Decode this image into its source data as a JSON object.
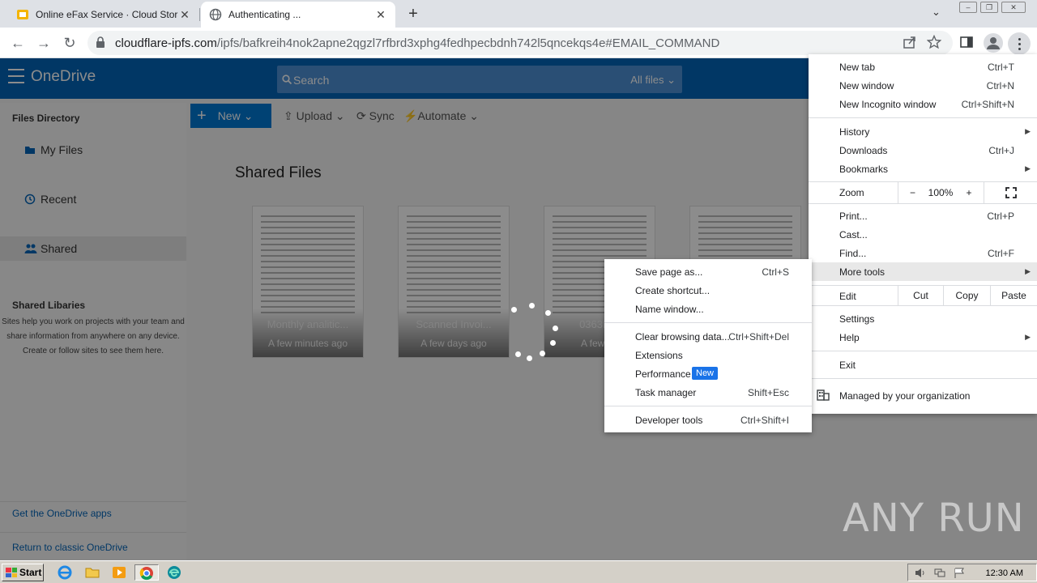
{
  "tabs": [
    {
      "title": "Online eFax Service · Cloud Storage",
      "icon": "fax-favicon"
    },
    {
      "title": "Authenticating ...",
      "icon": "globe-favicon"
    }
  ],
  "address": {
    "host": "cloudflare-ipfs.com",
    "path": "/ipfs/bafkreih4nok2apne2qgzl7rfbrd3xphg4fedhpecbdnh742l5qncekqs4e#EMAIL_COMMAND"
  },
  "onedrive": {
    "brand": "OneDrive",
    "search_placeholder": "Search",
    "search_scope": "All files"
  },
  "sidebar": {
    "heading": "Files Directory",
    "items": [
      {
        "label": "My Files"
      },
      {
        "label": "Recent"
      },
      {
        "label": "Shared"
      }
    ],
    "libraries_heading": "Shared Libaries",
    "libraries_desc": "Sites help you work on projects with your team and share information from anywhere on any device. Create or follow sites to see them here.",
    "get_apps": "Get the OneDrive apps",
    "return_classic": "Return to classic OneDrive"
  },
  "commands": {
    "new": "New",
    "upload": "Upload",
    "sync": "Sync",
    "automate": "Automate"
  },
  "main": {
    "title": "Shared Files",
    "tiles": [
      {
        "name": "Monthly analitic...",
        "time": "A few minutes ago"
      },
      {
        "name": "Scanned Invoi...",
        "time": "A few days ago"
      },
      {
        "name": "0363NTI",
        "time": "A few da"
      },
      {
        "name": "",
        "time": ""
      }
    ]
  },
  "chrome_menu": {
    "new_tab": "New tab",
    "new_tab_sc": "Ctrl+T",
    "new_window": "New window",
    "new_window_sc": "Ctrl+N",
    "incognito": "New Incognito window",
    "incognito_sc": "Ctrl+Shift+N",
    "history": "History",
    "downloads": "Downloads",
    "downloads_sc": "Ctrl+J",
    "bookmarks": "Bookmarks",
    "zoom": "Zoom",
    "zoom_minus": "−",
    "zoom_value": "100%",
    "zoom_plus": "+",
    "print": "Print...",
    "print_sc": "Ctrl+P",
    "cast": "Cast...",
    "find": "Find...",
    "find_sc": "Ctrl+F",
    "more_tools": "More tools",
    "edit": "Edit",
    "cut": "Cut",
    "copy": "Copy",
    "paste": "Paste",
    "settings": "Settings",
    "help": "Help",
    "exit": "Exit",
    "managed": "Managed by your organization"
  },
  "more_tools_menu": {
    "save_page": "Save page as...",
    "save_page_sc": "Ctrl+S",
    "create_shortcut": "Create shortcut...",
    "name_window": "Name window...",
    "clear_data": "Clear browsing data...",
    "clear_data_sc": "Ctrl+Shift+Del",
    "extensions": "Extensions",
    "performance": "Performance",
    "performance_badge": "New",
    "task_manager": "Task manager",
    "task_manager_sc": "Shift+Esc",
    "dev_tools": "Developer tools",
    "dev_tools_sc": "Ctrl+Shift+I"
  },
  "taskbar": {
    "start": "Start",
    "clock": "12:30 AM"
  },
  "watermark": "ANY RUN",
  "colors": {
    "onedrive_blue": "#0364b8",
    "new_button": "#0078d4",
    "badge": "#1a73e8"
  }
}
